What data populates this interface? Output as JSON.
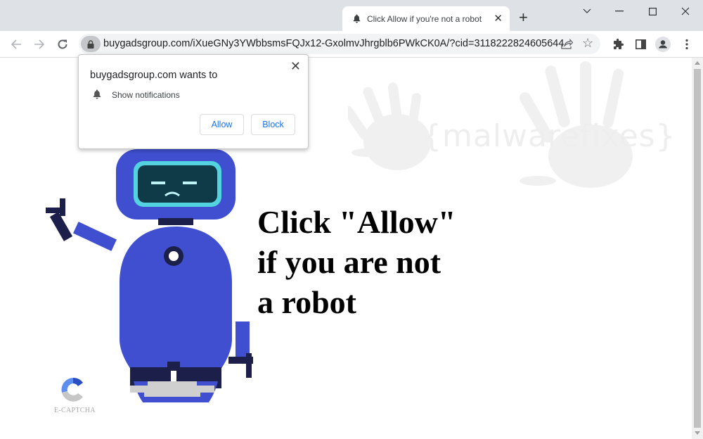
{
  "browser": {
    "tab": {
      "title": "Click Allow if you're not a robot",
      "icon": "bell-icon"
    },
    "new_tab_label": "+",
    "window_controls": {
      "tab_search": "⌄",
      "minimize": "—",
      "maximize": "☐",
      "close": "✕"
    },
    "address_bar": {
      "url": "buygadsgroup.com/iXueGNy3YWbbsmsFQJx12-GxolmvJhrgblb6PWkCK0A/?cid=3118222824605644",
      "icon": "lock-icon"
    },
    "toolbar_icons": [
      "back-icon",
      "forward-icon",
      "reload-icon",
      "share-icon",
      "star-icon",
      "extensions-icon",
      "side-panel-icon",
      "profile-icon",
      "menu-icon"
    ]
  },
  "permission_popup": {
    "title": "buygadsgroup.com wants to",
    "permission": "Show notifications",
    "allow_label": "Allow",
    "block_label": "Block",
    "close_label": "✕",
    "accent": "#1a73e8"
  },
  "page": {
    "headline_lines": [
      "Click \"Allow\"",
      "if you are not",
      "a robot"
    ],
    "watermark": "{malwarefixes}",
    "captcha_label": "E-CAPTCHA",
    "robot_color": "#3f4fd0",
    "robot_dark": "#1b1f4a",
    "visor_color": "#53d3e0"
  }
}
